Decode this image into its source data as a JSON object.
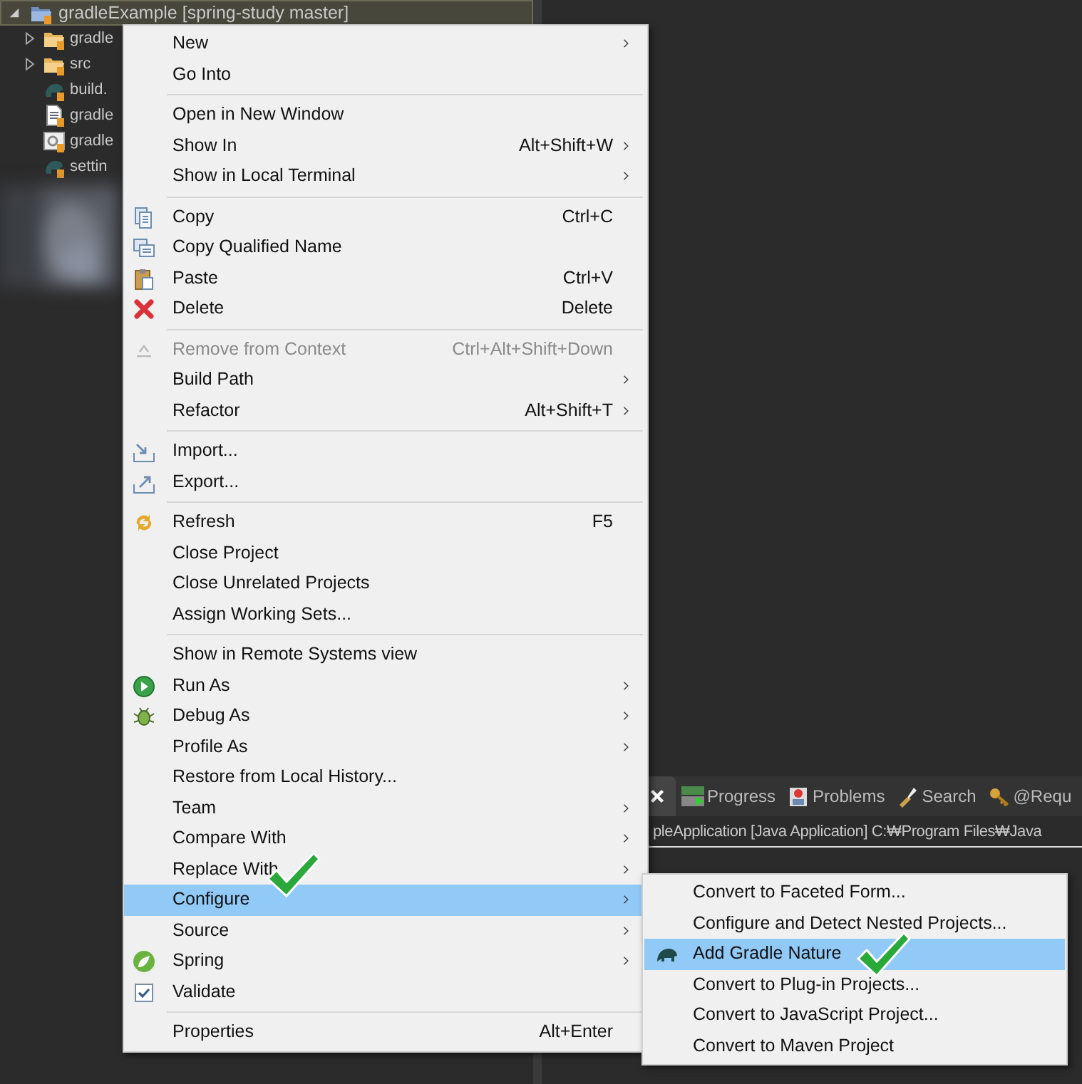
{
  "tree": {
    "root": {
      "label": "gradleExample [spring-study master]",
      "selected": true,
      "expanded": true
    },
    "children": [
      {
        "label": "gradle",
        "kind": "folder",
        "expanded": false
      },
      {
        "label": "src",
        "kind": "folder",
        "expanded": false
      },
      {
        "label": "build.",
        "kind": "gradle-file"
      },
      {
        "label": "gradle",
        "kind": "text-file"
      },
      {
        "label": "gradle",
        "kind": "settings-file"
      },
      {
        "label": "settin",
        "kind": "gradle-file"
      }
    ]
  },
  "bottom_panel": {
    "tabs": [
      {
        "label": "Progress",
        "kind": "progress"
      },
      {
        "label": "Problems",
        "kind": "problems"
      },
      {
        "label": "Search",
        "kind": "search"
      },
      {
        "label": "@Requ",
        "kind": "request"
      }
    ],
    "console_line": "pleApplication [Java Application] C:₩Program Files₩Java"
  },
  "context_menu": {
    "groups": [
      [
        {
          "label": "New",
          "submenu": true,
          "disabled": false,
          "selected": false
        },
        {
          "label": "Go Into",
          "submenu": false,
          "disabled": false,
          "selected": false
        }
      ],
      [
        {
          "label": "Open in New Window",
          "submenu": false,
          "disabled": false,
          "selected": false
        },
        {
          "label": "Show In",
          "shortcut": "Alt+Shift+W",
          "submenu": true,
          "disabled": false,
          "selected": false
        },
        {
          "label": "Show in Local Terminal",
          "submenu": true,
          "disabled": false,
          "selected": false
        }
      ],
      [
        {
          "label": "Copy",
          "shortcut": "Ctrl+C",
          "kind": "copy",
          "submenu": false,
          "disabled": false,
          "selected": false
        },
        {
          "label": "Copy Qualified Name",
          "kind": "copy-name",
          "submenu": false,
          "disabled": false,
          "selected": false
        },
        {
          "label": "Paste",
          "shortcut": "Ctrl+V",
          "kind": "paste",
          "submenu": false,
          "disabled": false,
          "selected": false
        },
        {
          "label": "Delete",
          "shortcut": "Delete",
          "kind": "delete",
          "submenu": false,
          "disabled": false,
          "selected": false
        }
      ],
      [
        {
          "label": "Remove from Context",
          "shortcut": "Ctrl+Alt+Shift+Down",
          "kind": "remove",
          "submenu": false,
          "disabled": true,
          "selected": false
        },
        {
          "label": "Build Path",
          "submenu": true,
          "disabled": false,
          "selected": false
        },
        {
          "label": "Refactor",
          "shortcut": "Alt+Shift+T",
          "submenu": true,
          "disabled": false,
          "selected": false
        }
      ],
      [
        {
          "label": "Import...",
          "kind": "import",
          "submenu": false,
          "disabled": false,
          "selected": false
        },
        {
          "label": "Export...",
          "kind": "export",
          "submenu": false,
          "disabled": false,
          "selected": false
        }
      ],
      [
        {
          "label": "Refresh",
          "shortcut": "F5",
          "kind": "refresh",
          "submenu": false,
          "disabled": false,
          "selected": false
        },
        {
          "label": "Close Project",
          "submenu": false,
          "disabled": false,
          "selected": false
        },
        {
          "label": "Close Unrelated Projects",
          "submenu": false,
          "disabled": false,
          "selected": false
        },
        {
          "label": "Assign Working Sets...",
          "submenu": false,
          "disabled": false,
          "selected": false
        }
      ],
      [
        {
          "label": "Show in Remote Systems view",
          "submenu": false,
          "disabled": false,
          "selected": false
        },
        {
          "label": "Run As",
          "kind": "run",
          "submenu": true,
          "disabled": false,
          "selected": false
        },
        {
          "label": "Debug As",
          "kind": "debug",
          "submenu": true,
          "disabled": false,
          "selected": false
        },
        {
          "label": "Profile As",
          "submenu": true,
          "disabled": false,
          "selected": false
        },
        {
          "label": "Restore from Local History...",
          "submenu": false,
          "disabled": false,
          "selected": false
        },
        {
          "label": "Team",
          "submenu": true,
          "disabled": false,
          "selected": false
        },
        {
          "label": "Compare With",
          "submenu": true,
          "disabled": false,
          "selected": false
        },
        {
          "label": "Replace With",
          "submenu": true,
          "disabled": false,
          "selected": false
        },
        {
          "label": "Configure",
          "submenu": true,
          "disabled": false,
          "selected": true
        },
        {
          "label": "Source",
          "submenu": true,
          "disabled": false,
          "selected": false
        },
        {
          "label": "Spring",
          "kind": "spring",
          "submenu": true,
          "disabled": false,
          "selected": false
        },
        {
          "label": "Validate",
          "kind": "validate",
          "submenu": false,
          "disabled": false,
          "selected": false
        }
      ],
      [
        {
          "label": "Properties",
          "shortcut": "Alt+Enter",
          "submenu": false,
          "disabled": false,
          "selected": false
        }
      ]
    ]
  },
  "configure_submenu": {
    "items": [
      {
        "label": "Convert to Faceted Form...",
        "selected": false
      },
      {
        "label": "Configure and Detect Nested Projects...",
        "selected": false
      },
      {
        "label": "Add Gradle Nature",
        "kind": "gradle",
        "selected": true
      },
      {
        "label": "Convert to Plug-in Projects...",
        "selected": false
      },
      {
        "label": "Convert to JavaScript Project...",
        "selected": false
      },
      {
        "label": "Convert to Maven Project",
        "selected": false
      }
    ]
  }
}
